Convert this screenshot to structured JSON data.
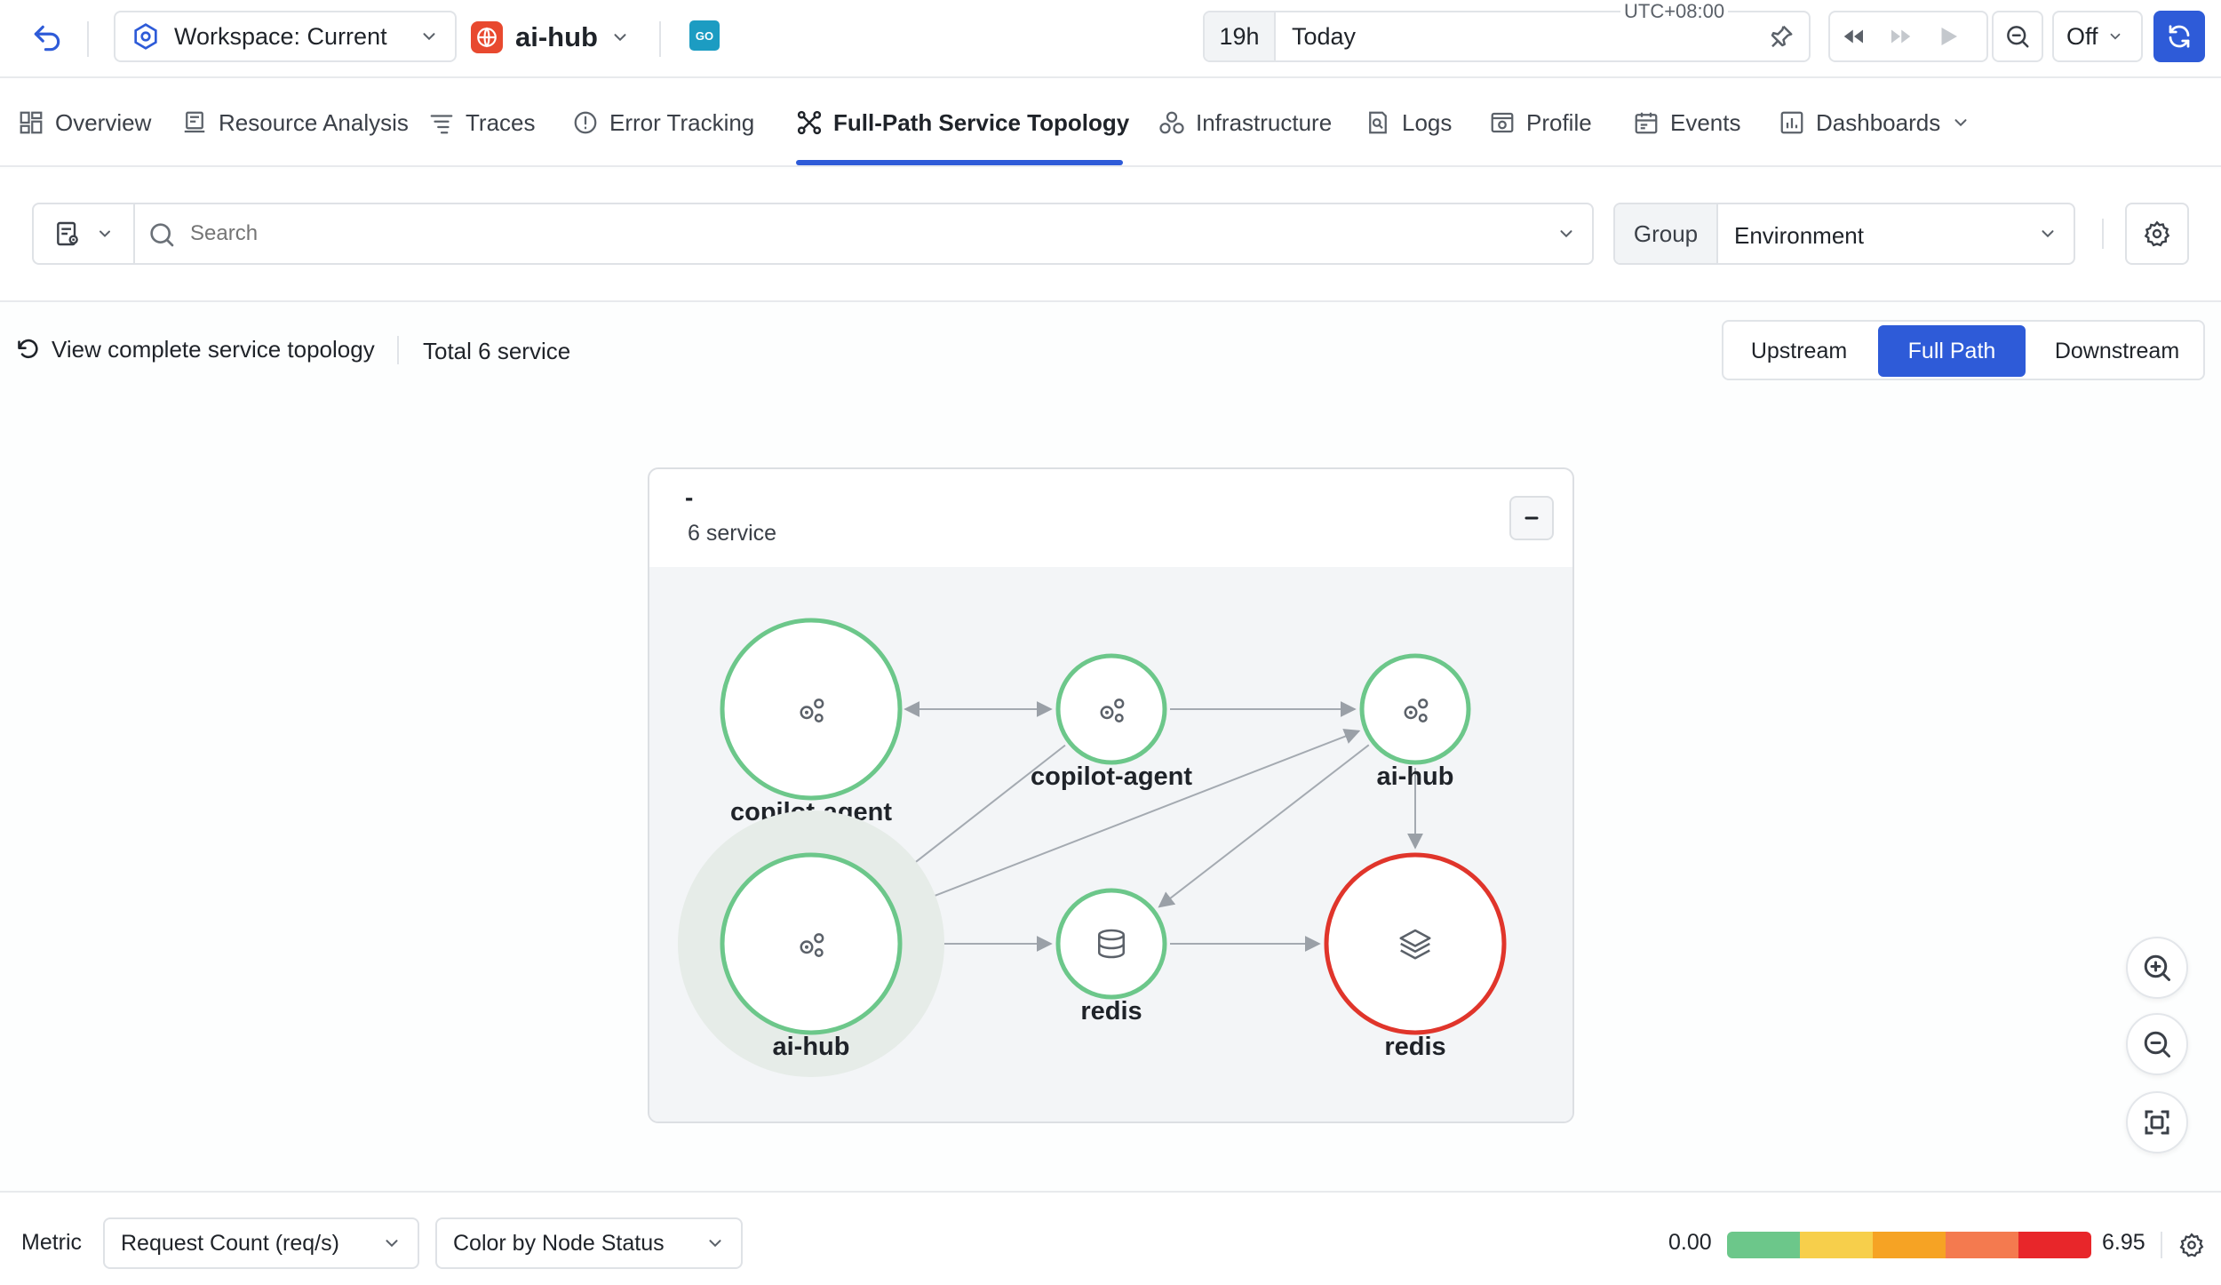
{
  "topbar": {
    "workspace_label": "Workspace: Current",
    "app_name": "ai-hub",
    "app_badge": "GO",
    "time_range_short": "19h",
    "time_range_label": "Today",
    "timezone": "UTC+08:00",
    "refresh_label": "Off",
    "accent_color": "#2e5bd8"
  },
  "nav": {
    "tabs": [
      {
        "label": "Overview",
        "icon": "overview-icon"
      },
      {
        "label": "Resource Analysis",
        "icon": "resource-icon"
      },
      {
        "label": "Traces",
        "icon": "traces-icon"
      },
      {
        "label": "Error Tracking",
        "icon": "error-icon"
      },
      {
        "label": "Full-Path Service Topology",
        "icon": "topology-icon",
        "active": true
      },
      {
        "label": "Infrastructure",
        "icon": "infrastructure-icon"
      },
      {
        "label": "Logs",
        "icon": "logs-icon"
      },
      {
        "label": "Profile",
        "icon": "profile-icon"
      },
      {
        "label": "Events",
        "icon": "events-icon"
      },
      {
        "label": "Dashboards",
        "icon": "dashboards-icon"
      }
    ]
  },
  "filter": {
    "search_placeholder": "Search",
    "group_label": "Group",
    "group_value": "Environment"
  },
  "topology": {
    "back_label": "View complete service topology",
    "total_label": "Total 6 service",
    "modes": [
      "Upstream",
      "Full Path",
      "Downstream"
    ],
    "active_mode": "Full Path",
    "group_title": "-",
    "group_count": "6 service",
    "nodes": [
      {
        "id": "n1",
        "label": "copilot-agent",
        "kind": "service",
        "status": "healthy",
        "size": "large"
      },
      {
        "id": "n2",
        "label": "copilot-agent",
        "kind": "service",
        "status": "healthy",
        "size": "small"
      },
      {
        "id": "n3",
        "label": "ai-hub",
        "kind": "service",
        "status": "healthy",
        "size": "small"
      },
      {
        "id": "n4",
        "label": "ai-hub",
        "kind": "service",
        "status": "healthy",
        "size": "large",
        "selected": true
      },
      {
        "id": "n5",
        "label": "redis",
        "kind": "database",
        "status": "healthy",
        "size": "small"
      },
      {
        "id": "n6",
        "label": "redis",
        "kind": "cache",
        "status": "critical",
        "size": "large"
      }
    ],
    "edges": [
      {
        "from": "n1",
        "to": "n2",
        "bidirectional": true
      },
      {
        "from": "n2",
        "to": "n3"
      },
      {
        "from": "n2",
        "to": "n4"
      },
      {
        "from": "n4",
        "to": "n3"
      },
      {
        "from": "n3",
        "to": "n5"
      },
      {
        "from": "n3",
        "to": "n6"
      },
      {
        "from": "n4",
        "to": "n5"
      },
      {
        "from": "n5",
        "to": "n6"
      }
    ],
    "status_colors": {
      "healthy": "#6cc78a",
      "critical": "#e0352b"
    }
  },
  "footer": {
    "metric_label": "Metric",
    "metric_value": "Request Count (req/s)",
    "color_mode": "Color by Node Status",
    "scale_min": "0.00",
    "scale_max": "6.95",
    "scale_colors": [
      "#6cc78a",
      "#f7cf4b",
      "#f6a324",
      "#f47a4f",
      "#e8262a"
    ]
  }
}
